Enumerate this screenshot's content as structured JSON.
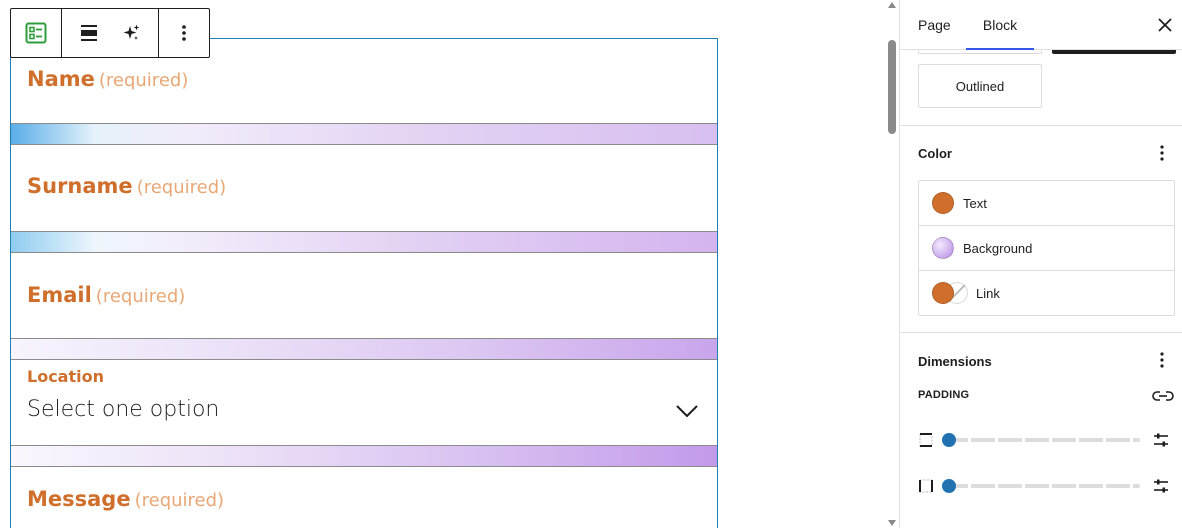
{
  "form": {
    "fields": [
      {
        "label": "Name",
        "required": "(required)"
      },
      {
        "label": "Surname",
        "required": "(required)"
      },
      {
        "label": "Email",
        "required": "(required)"
      },
      {
        "label": "Message",
        "required": "(required)"
      }
    ],
    "location": {
      "label": "Location",
      "value": "Select one option"
    }
  },
  "toolbar": {
    "icons": [
      "form-block-icon",
      "align-icon",
      "sparkle-icon",
      "more-options-icon"
    ]
  },
  "sidebar": {
    "tabs": [
      {
        "label": "Page"
      },
      {
        "label": "Block"
      }
    ],
    "active_tab": "Block",
    "styles": {
      "outlined_label": "Outlined"
    },
    "color": {
      "title": "Color",
      "items": [
        {
          "label": "Text",
          "swatch": "#d06f2b"
        },
        {
          "label": "Background",
          "swatch": "#c9a5ec"
        },
        {
          "label": "Link",
          "swatch": "#d06f2b"
        }
      ]
    },
    "dimensions": {
      "title": "Dimensions",
      "padding_label": "Padding",
      "padding_values": [
        0,
        0
      ]
    }
  },
  "colors": {
    "accent": "#2271b1",
    "label_orange": "#d06f2b",
    "required_orange": "#e9a775",
    "tab_indicator": "#3858e9",
    "block_outline": "#1e7fb6"
  }
}
